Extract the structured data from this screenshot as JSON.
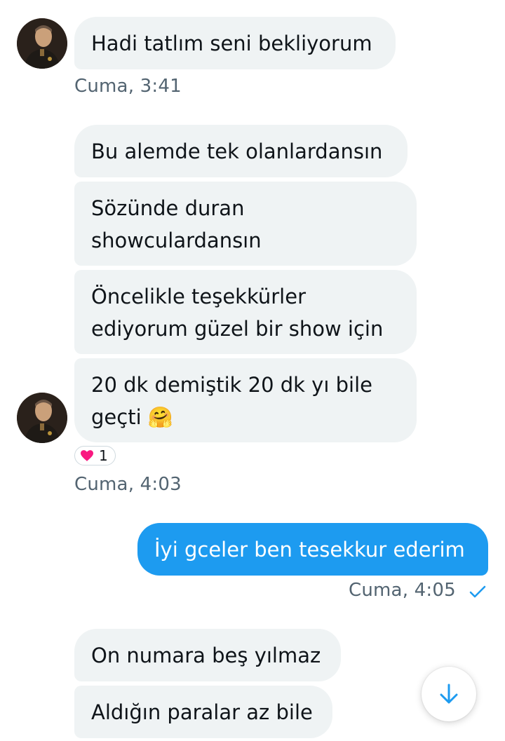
{
  "messages": {
    "m1": "Hadi tatlım seni bekliyorum",
    "m1_time": "Cuma, 3:41",
    "m2": "Bu alemde tek olanlardansın",
    "m3_line1": "Sözünde duran",
    "m3_line2": "showculardansın",
    "m4_line1": "Öncelikle teşekkürler",
    "m4_line2": "ediyorum güzel bir show için",
    "m5_line1": "20 dk demiştik 20 dk yı bile",
    "m5_line2": "geçti 🤗",
    "reaction_count": "1",
    "group2_time": "Cuma, 4:03",
    "out1": "İyi gceler ben tesekkur ederim",
    "out1_time": "Cuma, 4:05",
    "m6": "On numara beş yılmaz",
    "m7": "Aldığın paralar az bile"
  },
  "icons": {
    "reaction": "heart-icon",
    "read_receipt": "checkmark-icon",
    "scroll_down": "arrow-down-icon"
  },
  "colors": {
    "incoming_bubble": "#eff3f4",
    "outgoing_bubble": "#1d9bf0",
    "meta_text": "#536471",
    "accent": "#1d9bf0",
    "heart": "#f91880"
  }
}
